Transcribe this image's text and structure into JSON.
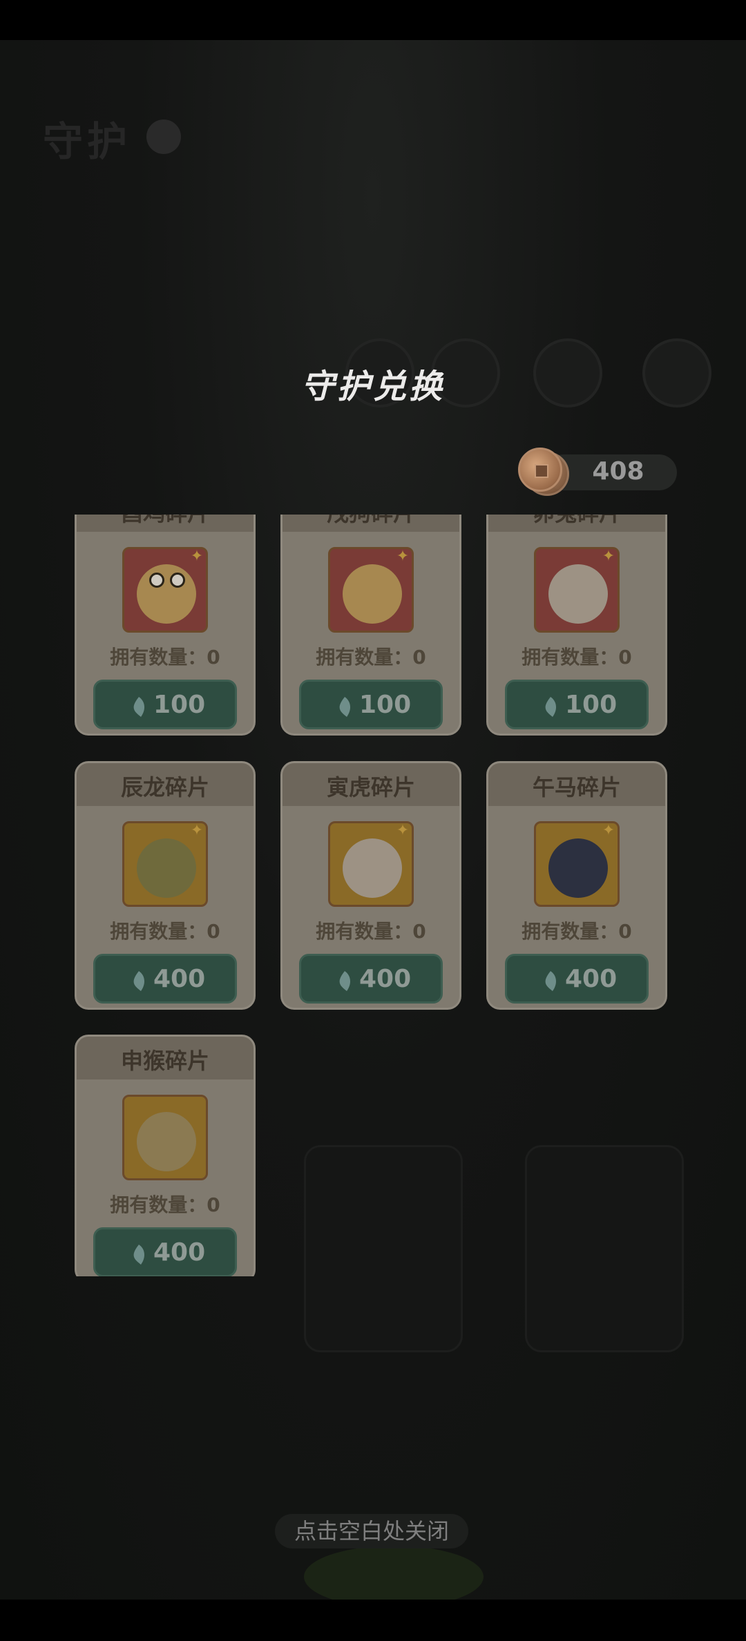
{
  "modal": {
    "title": "守护兑换",
    "coin_balance": "408",
    "close_hint": "点击空白处关闭"
  },
  "cards": [
    {
      "name": "酉鸡碎片",
      "owned": "拥有数量：0",
      "price": "100",
      "icon": "rooster-portrait-icon"
    },
    {
      "name": "戌狗碎片",
      "owned": "拥有数量：0",
      "price": "100",
      "icon": "dog-portrait-icon"
    },
    {
      "name": "卯兔碎片",
      "owned": "拥有数量：0",
      "price": "100",
      "icon": "rabbit-portrait-icon"
    },
    {
      "name": "辰龙碎片",
      "owned": "拥有数量：0",
      "price": "400",
      "icon": "dragon-portrait-icon"
    },
    {
      "name": "寅虎碎片",
      "owned": "拥有数量：0",
      "price": "400",
      "icon": "tiger-portrait-icon"
    },
    {
      "name": "午马碎片",
      "owned": "拥有数量：0",
      "price": "400",
      "icon": "horse-portrait-icon"
    },
    {
      "name": "申猴碎片",
      "owned": "拥有数量：0",
      "price": "400",
      "icon": "monkey-portrait-icon"
    }
  ],
  "colors": {
    "overlay": "#131413",
    "card": "#807a6f",
    "card_header": "#6d665b",
    "button": "#2e4d41",
    "title": "#ecebea"
  }
}
